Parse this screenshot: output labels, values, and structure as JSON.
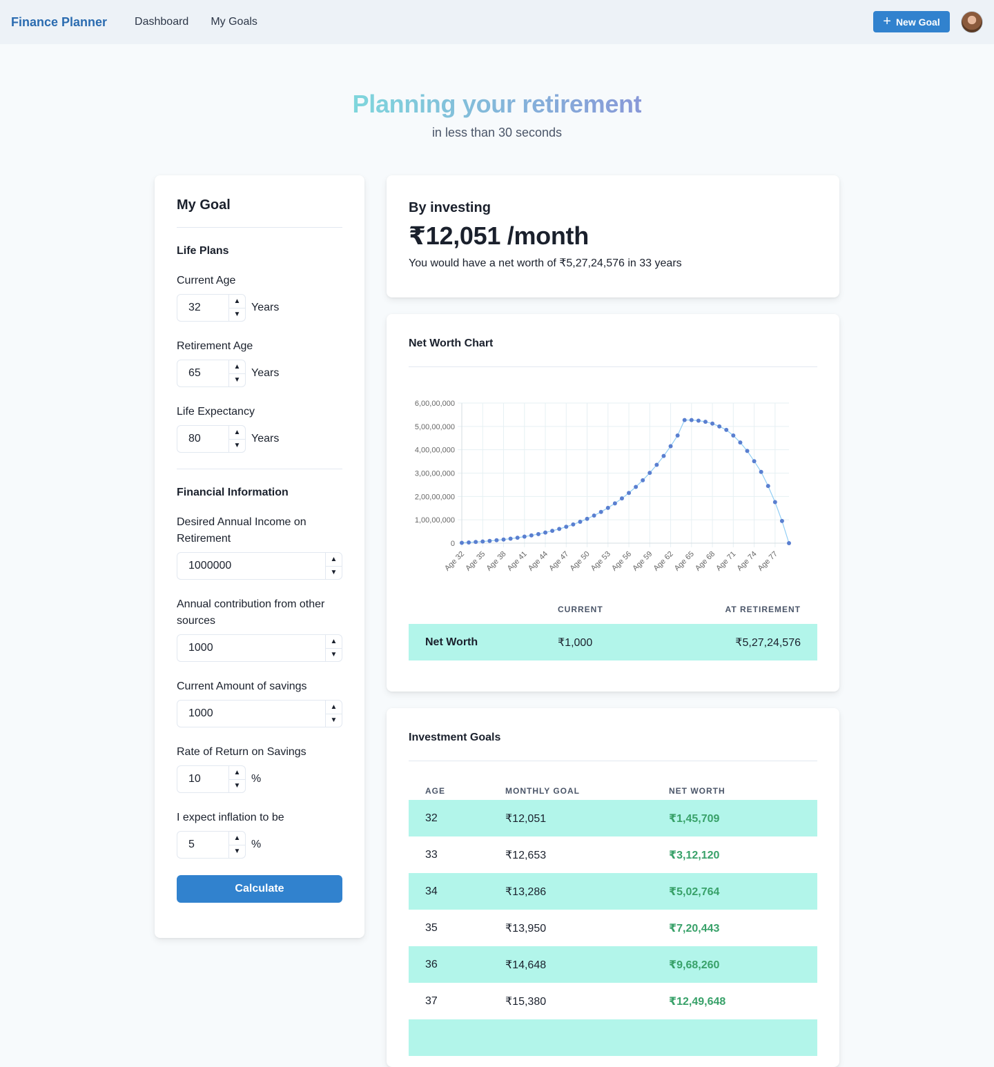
{
  "nav": {
    "brand": "Finance Planner",
    "links": [
      "Dashboard",
      "My Goals"
    ],
    "new_goal": "New Goal",
    "new_goal_icon": "plus-icon"
  },
  "hero": {
    "title": "Planning your retirement",
    "subtitle": "in less than 30 seconds",
    "gradient": [
      "#7fd6dc",
      "#8898d8"
    ]
  },
  "goal": {
    "title": "My Goal",
    "life_section": "Life Plans",
    "current_age": {
      "label": "Current Age",
      "value": "32",
      "unit": "Years"
    },
    "retirement_age": {
      "label": "Retirement Age",
      "value": "65",
      "unit": "Years"
    },
    "life_expectancy": {
      "label": "Life Expectancy",
      "value": "80",
      "unit": "Years"
    },
    "fin_section": "Financial Information",
    "desired_income": {
      "label": "Desired Annual Income on Retirement",
      "value": "1000000"
    },
    "other_contrib": {
      "label": "Annual contribution from other sources",
      "value": "1000"
    },
    "current_savings": {
      "label": "Current Amount of savings",
      "value": "1000"
    },
    "return_rate": {
      "label": "Rate of Return on Savings",
      "value": "10",
      "unit": "%"
    },
    "inflation": {
      "label": "I expect inflation to be",
      "value": "5",
      "unit": "%"
    },
    "calculate": "Calculate"
  },
  "summary": {
    "label": "By investing",
    "amount": "₹12,051 /month",
    "text": "You would have a net worth of ₹5,27,24,576 in 33 years"
  },
  "chart_card": {
    "title": "Net Worth Chart",
    "headers": [
      "",
      "CURRENT",
      "AT RETIREMENT"
    ],
    "row_label": "Net Worth",
    "current": "₹1,000",
    "at_retirement": "₹5,27,24,576"
  },
  "chart_data": {
    "type": "line",
    "x": [
      "Age 32",
      "Age 33",
      "Age 34",
      "Age 35",
      "Age 36",
      "Age 37",
      "Age 38",
      "Age 39",
      "Age 40",
      "Age 41",
      "Age 42",
      "Age 43",
      "Age 44",
      "Age 45",
      "Age 46",
      "Age 47",
      "Age 48",
      "Age 49",
      "Age 50",
      "Age 51",
      "Age 52",
      "Age 53",
      "Age 54",
      "Age 55",
      "Age 56",
      "Age 57",
      "Age 58",
      "Age 59",
      "Age 60",
      "Age 61",
      "Age 62",
      "Age 63",
      "Age 64",
      "Age 65",
      "Age 66",
      "Age 67",
      "Age 68",
      "Age 69",
      "Age 70",
      "Age 71",
      "Age 72",
      "Age 73",
      "Age 74",
      "Age 75",
      "Age 76",
      "Age 77",
      "Age 78",
      "Age 79"
    ],
    "tick_labels": [
      "Age 32",
      "Age 35",
      "Age 38",
      "Age 41",
      "Age 44",
      "Age 47",
      "Age 50",
      "Age 53",
      "Age 56",
      "Age 59",
      "Age 62",
      "Age 65",
      "Age 68",
      "Age 71",
      "Age 74",
      "Age 77"
    ],
    "series": [
      {
        "values": [
          145709,
          312120,
          502764,
          720443,
          968260,
          1249648,
          1568400,
          1929000,
          2336000,
          2795000,
          3312000,
          3894000,
          4546000,
          5277000,
          6095000,
          7009000,
          8029000,
          9164000,
          10430000,
          11830000,
          13390000,
          15120000,
          17040000,
          19160000,
          21510000,
          24100000,
          26950000,
          30100000,
          33550000,
          37360000,
          41530000,
          46100000,
          52724576,
          52724576,
          52450000,
          52000000,
          51200000,
          50000000,
          48500000,
          46100000,
          43100000,
          39500000,
          35100000,
          30500000,
          24500000,
          17600000,
          9500000,
          0
        ]
      }
    ],
    "y_ticks": [
      "0",
      "1,00,00,000",
      "2,00,00,000",
      "3,00,00,000",
      "4,00,00,000",
      "5,00,00,000",
      "6,00,00,000"
    ],
    "ylim": [
      0,
      60000000
    ],
    "grid": true,
    "line_color": "#90cdf4",
    "point_color": "#5a7fd0"
  },
  "investment": {
    "title": "Investment Goals",
    "headers": [
      "AGE",
      "MONTHLY GOAL",
      "NET WORTH"
    ],
    "rows": [
      {
        "age": "32",
        "goal": "₹12,051",
        "net": "₹1,45,709"
      },
      {
        "age": "33",
        "goal": "₹12,653",
        "net": "₹3,12,120"
      },
      {
        "age": "34",
        "goal": "₹13,286",
        "net": "₹5,02,764"
      },
      {
        "age": "35",
        "goal": "₹13,950",
        "net": "₹7,20,443"
      },
      {
        "age": "36",
        "goal": "₹14,648",
        "net": "₹9,68,260"
      },
      {
        "age": "37",
        "goal": "₹15,380",
        "net": "₹12,49,648"
      }
    ]
  },
  "colors": {
    "primary": "#3182ce",
    "teal_row": "#b2f5ea",
    "green": "#38a169"
  }
}
